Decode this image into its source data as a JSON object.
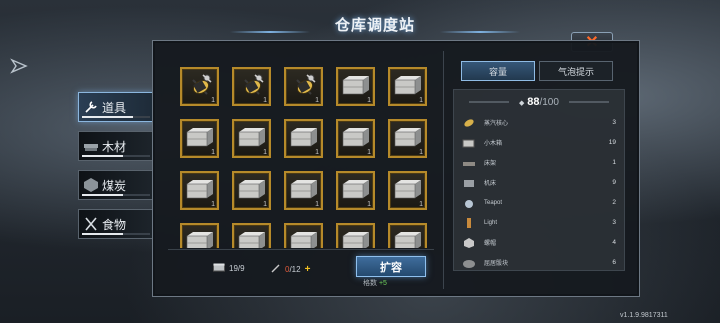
{
  "title": "仓库调度站",
  "close_icon": "close-x-icon",
  "colors": {
    "accent_gold": "#b68a2a",
    "accent_blue": "#7eb1e0",
    "close_orange": "#ff6a2a",
    "green": "#6fd05a"
  },
  "side_tabs": [
    {
      "label": "道具",
      "icon": "wrench-screwdriver-icon",
      "active": true,
      "fill_pct": 75
    },
    {
      "label": "木材",
      "icon": "wood-plank-icon",
      "active": false,
      "fill_pct": 60
    },
    {
      "label": "煤炭",
      "icon": "coal-lump-icon",
      "active": false,
      "fill_pct": 60
    },
    {
      "label": "食物",
      "icon": "fork-knife-icon",
      "active": false,
      "fill_pct": 60
    }
  ],
  "grid": {
    "rows": [
      [
        {
          "item": "steam-core",
          "count": "1"
        },
        {
          "item": "steam-core",
          "count": "1"
        },
        {
          "item": "steam-core",
          "count": "1"
        },
        {
          "item": "crate",
          "count": "1"
        },
        {
          "item": "crate",
          "count": "1"
        }
      ],
      [
        {
          "item": "crate",
          "count": "1"
        },
        {
          "item": "crate",
          "count": "1"
        },
        {
          "item": "crate",
          "count": "1"
        },
        {
          "item": "crate",
          "count": "1"
        },
        {
          "item": "crate",
          "count": "1"
        }
      ],
      [
        {
          "item": "crate",
          "count": "1"
        },
        {
          "item": "crate",
          "count": "1"
        },
        {
          "item": "crate",
          "count": "1"
        },
        {
          "item": "crate",
          "count": "1"
        },
        {
          "item": "crate",
          "count": "1"
        }
      ],
      [
        {
          "item": "crate",
          "count": ""
        },
        {
          "item": "crate",
          "count": ""
        },
        {
          "item": "crate",
          "count": ""
        },
        {
          "item": "crate",
          "count": ""
        },
        {
          "item": "crate",
          "count": ""
        }
      ]
    ]
  },
  "footer": {
    "crate_count": "19/9",
    "tool_used": "0",
    "tool_total": "/12",
    "expand_label": "扩容",
    "slots_label": "格数",
    "slots_bonus": "+5"
  },
  "right_tabs": [
    "容量",
    "气泡提示"
  ],
  "capacity": {
    "current": "88",
    "max": "/100"
  },
  "inventory_list": [
    {
      "name": "蒸汽核心",
      "value": "3",
      "icon": "steam-core-icon"
    },
    {
      "name": "小木箱",
      "value": "19",
      "icon": "small-crate-icon"
    },
    {
      "name": "床架",
      "value": "1",
      "icon": "bed-frame-icon"
    },
    {
      "name": "机床",
      "value": "9",
      "icon": "machine-tool-icon"
    },
    {
      "name": "Teapot",
      "value": "2",
      "icon": "teapot-icon"
    },
    {
      "name": "Light",
      "value": "3",
      "icon": "lamp-icon"
    },
    {
      "name": "螺帽",
      "value": "4",
      "icon": "nut-icon"
    },
    {
      "name": "屈居骰块",
      "value": "6",
      "icon": "stone-block-icon"
    }
  ],
  "version": "v1.1.9.9817311"
}
